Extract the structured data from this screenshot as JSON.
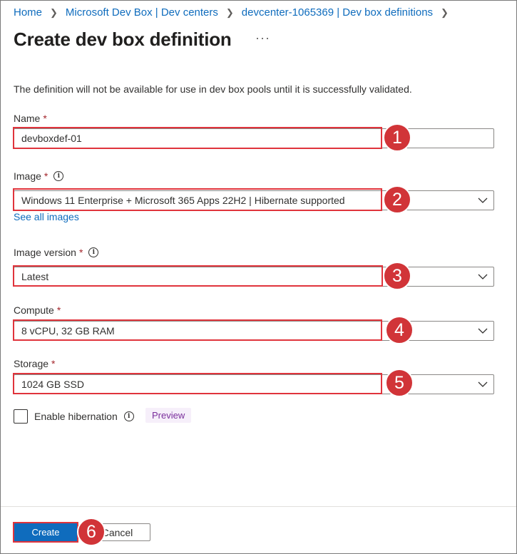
{
  "breadcrumb": {
    "items": [
      "Home",
      "Microsoft Dev Box | Dev centers",
      "devcenter-1065369 | Dev box definitions"
    ]
  },
  "page": {
    "title": "Create dev box definition",
    "more": "···",
    "info_text": "The definition will not be available for use in dev box pools until it is successfully validated."
  },
  "form": {
    "required_mark": "*",
    "name": {
      "label": "Name",
      "value": "devboxdef-01"
    },
    "image": {
      "label": "Image",
      "value": "Windows 11 Enterprise + Microsoft 365 Apps 22H2 | Hibernate supported",
      "link": "See all images"
    },
    "image_version": {
      "label": "Image version",
      "value": "Latest"
    },
    "compute": {
      "label": "Compute",
      "value": "8 vCPU, 32 GB RAM"
    },
    "storage": {
      "label": "Storage",
      "value": "1024 GB SSD"
    },
    "hibernation": {
      "label": "Enable hibernation",
      "checked": false,
      "badge": "Preview"
    },
    "info_glyph": "i"
  },
  "footer": {
    "create_label": "Create",
    "cancel_label": "Cancel"
  },
  "callouts": [
    "1",
    "2",
    "3",
    "4",
    "5",
    "6"
  ],
  "colors": {
    "accent": "#0f6cbd",
    "callout": "#d13438",
    "highlight": "#e0343c",
    "required": "#a4262c"
  }
}
